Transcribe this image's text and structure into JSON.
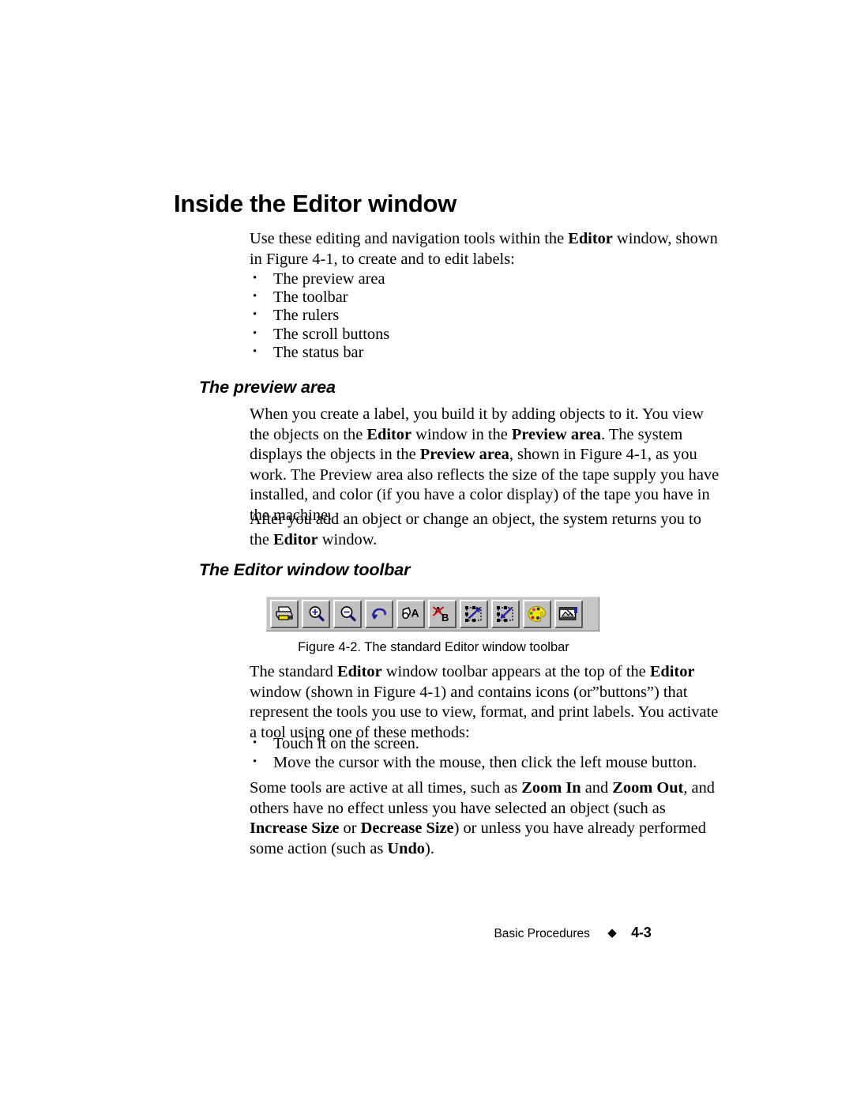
{
  "document": {
    "heading": "Inside the Editor window",
    "intro_paragraph_html": "Use these editing and navigation tools within the <b>Editor</b> window, shown in Figure 4-1, to create and to edit labels:",
    "parts_list": [
      "The preview area",
      "The toolbar",
      "The rulers",
      "The scroll buttons",
      "The status bar"
    ],
    "section_preview": {
      "heading": "The preview area",
      "paragraph1_html": "When you create a label, you build it by adding objects to it. You view the objects on the <b>Editor</b> window in the <b>Preview area</b>. The system displays the objects in the <b>Preview area</b>, shown in Figure 4-1, as you work. The Preview area also reflects the size of the tape supply you have installed, and color (if you have a color display) of the tape you have in the machine.",
      "paragraph2_html": "After you add an object or change an object, the system returns you to the <b>Editor</b> window."
    },
    "section_toolbar": {
      "heading": "The Editor window toolbar",
      "figure_caption": "Figure 4-2. The standard Editor window toolbar",
      "paragraph1_html": "The standard <b>Editor</b> window toolbar appears at the top of the <b>Editor</b> window (shown in Figure 4-1) and contains icons (or”buttons”) that represent the tools you use to view, format, and print labels. You activate a tool using one of these methods:",
      "methods_list": [
        "Touch it on the screen.",
        "Move the cursor with the mouse, then click the left mouse button."
      ],
      "paragraph2_html": "Some tools are active at all times, such as <b>Zoom In</b> and <b>Zoom Out</b>, and others have no effect unless you have selected an object (such as <b>Increase Size</b> or <b>Decrease Size</b>) or unless you have already performed some action (such as <b>Undo</b>)."
    },
    "toolbar_buttons": [
      {
        "icon": "print-icon",
        "label": "Print"
      },
      {
        "icon": "zoom-in-icon",
        "label": "Zoom In"
      },
      {
        "icon": "zoom-out-icon",
        "label": "Zoom Out"
      },
      {
        "icon": "undo-icon",
        "label": "Undo"
      },
      {
        "icon": "add-text-icon",
        "label": "Add Text Object"
      },
      {
        "icon": "replace-text-icon",
        "label": "Replace Text"
      },
      {
        "icon": "increase-size-icon",
        "label": "Increase Size"
      },
      {
        "icon": "decrease-size-icon",
        "label": "Decrease Size"
      },
      {
        "icon": "color-palette-icon",
        "label": "Color"
      },
      {
        "icon": "graphic-icon",
        "label": "Graphic"
      }
    ],
    "footer": {
      "chapter": "Basic Procedures",
      "separator": "◆",
      "page_number": "4-3"
    },
    "colors": {
      "toolbar_face": "#c0c0c0",
      "toolbar_highlight": "#ffffff",
      "toolbar_shadow": "#5a5a5a",
      "accent_blue": "#22239c",
      "accent_red": "#d01010",
      "palette_yellow": "#f2e30c",
      "text": "#000000"
    }
  }
}
